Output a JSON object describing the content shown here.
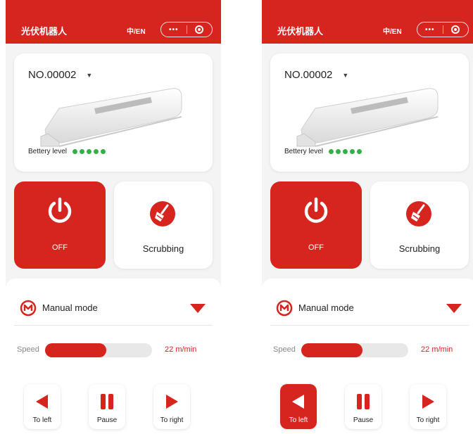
{
  "colors": {
    "accent": "#d6241f",
    "battery": "#33b04a"
  },
  "screens": [
    {
      "header": {
        "title": "光伏机器人",
        "lang_toggle": "中/EN",
        "more_icon": "more-dots-icon",
        "close_icon": "target-icon"
      },
      "device": {
        "id": "NO.00002",
        "battery_label": "Bettery level",
        "battery_bars": 5
      },
      "power": {
        "label": "OFF",
        "icon": "power-icon"
      },
      "scrub": {
        "label": "Scrubbing",
        "icon": "broom-icon"
      },
      "mode": {
        "label": "Manual mode",
        "icon": "m-circle-icon"
      },
      "speed": {
        "label": "Speed",
        "value": "22",
        "unit": "m/min",
        "fill_fraction": 0.57
      },
      "controls": {
        "left": {
          "label": "To left",
          "active": false
        },
        "pause": {
          "label": "Pause",
          "active": false
        },
        "right": {
          "label": "To right",
          "active": false
        }
      }
    },
    {
      "header": {
        "title": "光伏机器人",
        "lang_toggle": "中/EN",
        "more_icon": "more-dots-icon",
        "close_icon": "target-icon"
      },
      "device": {
        "id": "NO.00002",
        "battery_label": "Bettery level",
        "battery_bars": 5
      },
      "power": {
        "label": "OFF",
        "icon": "power-icon"
      },
      "scrub": {
        "label": "Scrubbing",
        "icon": "broom-icon"
      },
      "mode": {
        "label": "Manual mode",
        "icon": "m-circle-icon"
      },
      "speed": {
        "label": "Speed",
        "value": "22",
        "unit": "m/min",
        "fill_fraction": 0.57
      },
      "controls": {
        "left": {
          "label": "To left",
          "active": true
        },
        "pause": {
          "label": "Pause",
          "active": false
        },
        "right": {
          "label": "To right",
          "active": false
        }
      }
    }
  ]
}
